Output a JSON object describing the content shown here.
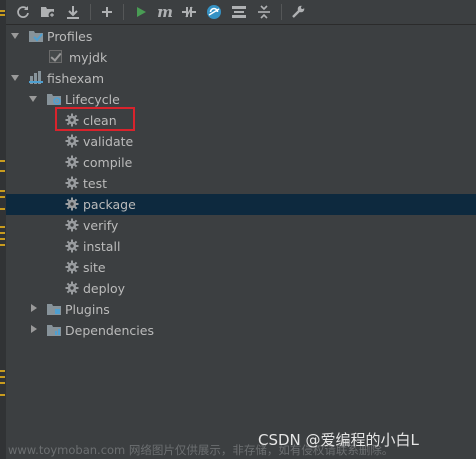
{
  "toolbar": {
    "buttons": [
      {
        "icon": "refresh-icon"
      },
      {
        "icon": "add-maven-project-icon"
      },
      {
        "icon": "download-sources-icon"
      },
      {
        "icon": "plus-icon"
      },
      {
        "icon": "run-icon"
      },
      {
        "icon": "execute-maven-goal-icon",
        "text": "m"
      },
      {
        "icon": "toggle-offline-icon"
      },
      {
        "icon": "skip-tests-icon"
      },
      {
        "icon": "show-dependencies-icon"
      },
      {
        "icon": "collapse-all-icon"
      },
      {
        "icon": "maven-settings-icon"
      }
    ]
  },
  "tree": {
    "profiles": {
      "label": "Profiles",
      "expanded": true
    },
    "profile_item": {
      "label": "myjdk",
      "checked": true
    },
    "project": {
      "label": "fishexam",
      "expanded": true
    },
    "lifecycle": {
      "label": "Lifecycle",
      "expanded": true
    },
    "phases": [
      {
        "label": "clean",
        "highlighted": true
      },
      {
        "label": "validate"
      },
      {
        "label": "compile"
      },
      {
        "label": "test"
      },
      {
        "label": "package",
        "selected": true
      },
      {
        "label": "verify"
      },
      {
        "label": "install"
      },
      {
        "label": "site"
      },
      {
        "label": "deploy"
      }
    ],
    "plugins": {
      "label": "Plugins",
      "expanded": false
    },
    "dependencies": {
      "label": "Dependencies",
      "expanded": false
    }
  },
  "watermark": {
    "left_text": "www.toymoban.com 网络图片仅供展示，非存储，如有侵权请联系删除。",
    "right_text": "CSDN @爱编程的小白L"
  },
  "colors": {
    "background": "#3c3f41",
    "selection": "#0d293e",
    "highlight_box": "#d9232c",
    "run_green": "#499c54",
    "accent_blue": "#3592c4"
  }
}
